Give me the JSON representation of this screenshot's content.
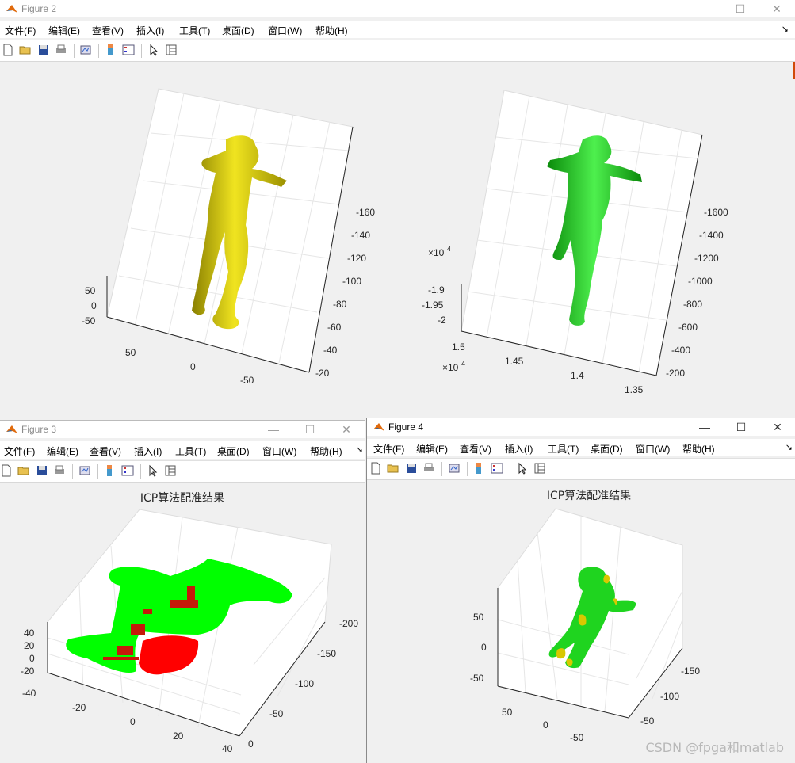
{
  "menu": [
    "文件(F)",
    "编辑(E)",
    "查看(V)",
    "插入(I)",
    "工具(T)",
    "桌面(D)",
    "窗口(W)",
    "帮助(H)"
  ],
  "colors": {
    "yellow_body": "#d4c800",
    "green_body": "#17c417",
    "red_points": "#ff0000",
    "green_points": "#00ff00",
    "matlab_icon": "#e06a0c"
  },
  "icons": [
    "new-file-icon",
    "open-folder-icon",
    "save-icon",
    "print-icon",
    "link-plot-icon",
    "colorbar-icon",
    "legend-icon",
    "pointer-icon",
    "property-inspector-icon"
  ],
  "figure2": {
    "title": "Figure 2",
    "left_plot": {
      "z_ticks": [
        "50",
        "0",
        "-50"
      ],
      "x_ticks": [
        "50",
        "0",
        "-50"
      ],
      "y_ticks": [
        "-160",
        "-140",
        "-120",
        "-100",
        "-80",
        "-60",
        "-40",
        "-20"
      ]
    },
    "right_plot": {
      "z_exp": "×10",
      "z_exp_power": "4",
      "z_ticks": [
        "-1.9",
        "-1.95",
        "-2"
      ],
      "x_exp": "×10",
      "x_exp_power": "4",
      "x_ticks": [
        "1.5",
        "1.45",
        "1.4",
        "1.35"
      ],
      "y_ticks": [
        "-1600",
        "-1400",
        "-1200",
        "-1000",
        "-800",
        "-600",
        "-400",
        "-200"
      ]
    }
  },
  "figure3": {
    "title": "Figure 3",
    "plot_title": "ICP算法配准结果",
    "z_ticks": [
      "40",
      "20",
      "0",
      "-20"
    ],
    "x_ticks": [
      "-40",
      "-20",
      "0",
      "20",
      "40"
    ],
    "y_ticks": [
      "-200",
      "-150",
      "-100",
      "-50",
      "0"
    ]
  },
  "figure4": {
    "title": "Figure 4",
    "plot_title": "ICP算法配准结果",
    "z_ticks": [
      "50",
      "0",
      "-50"
    ],
    "x_ticks": [
      "50",
      "0",
      "-50"
    ],
    "y_ticks": [
      "-150",
      "-100",
      "-50"
    ]
  },
  "watermark": "CSDN @fpga和matlab"
}
